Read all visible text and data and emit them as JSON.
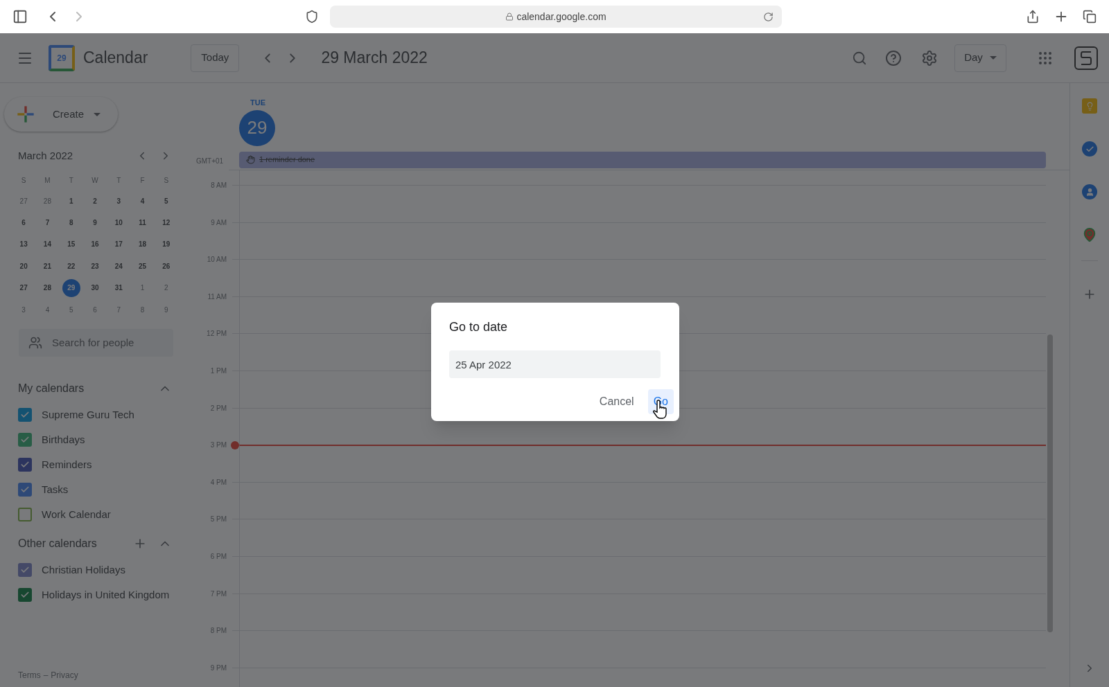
{
  "browser": {
    "url": "calendar.google.com"
  },
  "header": {
    "app_name": "Calendar",
    "logo_date": "29",
    "today_button": "Today",
    "title": "29 March 2022",
    "view_selector": "Day"
  },
  "create_button": "Create",
  "mini_calendar": {
    "month": "March 2022",
    "weekdays": [
      "S",
      "M",
      "T",
      "W",
      "T",
      "F",
      "S"
    ],
    "weeks": [
      [
        {
          "day": "27",
          "muted": true,
          "selected": false
        },
        {
          "day": "28",
          "muted": true,
          "selected": false
        },
        {
          "day": "1",
          "muted": false,
          "selected": false
        },
        {
          "day": "2",
          "muted": false,
          "selected": false
        },
        {
          "day": "3",
          "muted": false,
          "selected": false
        },
        {
          "day": "4",
          "muted": false,
          "selected": false
        },
        {
          "day": "5",
          "muted": false,
          "selected": false
        }
      ],
      [
        {
          "day": "6",
          "muted": false,
          "selected": false
        },
        {
          "day": "7",
          "muted": false,
          "selected": false
        },
        {
          "day": "8",
          "muted": false,
          "selected": false
        },
        {
          "day": "9",
          "muted": false,
          "selected": false
        },
        {
          "day": "10",
          "muted": false,
          "selected": false
        },
        {
          "day": "11",
          "muted": false,
          "selected": false
        },
        {
          "day": "12",
          "muted": false,
          "selected": false
        }
      ],
      [
        {
          "day": "13",
          "muted": false,
          "selected": false
        },
        {
          "day": "14",
          "muted": false,
          "selected": false
        },
        {
          "day": "15",
          "muted": false,
          "selected": false
        },
        {
          "day": "16",
          "muted": false,
          "selected": false
        },
        {
          "day": "17",
          "muted": false,
          "selected": false
        },
        {
          "day": "18",
          "muted": false,
          "selected": false
        },
        {
          "day": "19",
          "muted": false,
          "selected": false
        }
      ],
      [
        {
          "day": "20",
          "muted": false,
          "selected": false
        },
        {
          "day": "21",
          "muted": false,
          "selected": false
        },
        {
          "day": "22",
          "muted": false,
          "selected": false
        },
        {
          "day": "23",
          "muted": false,
          "selected": false
        },
        {
          "day": "24",
          "muted": false,
          "selected": false
        },
        {
          "day": "25",
          "muted": false,
          "selected": false
        },
        {
          "day": "26",
          "muted": false,
          "selected": false
        }
      ],
      [
        {
          "day": "27",
          "muted": false,
          "selected": false
        },
        {
          "day": "28",
          "muted": false,
          "selected": false
        },
        {
          "day": "29",
          "muted": false,
          "selected": true
        },
        {
          "day": "30",
          "muted": false,
          "selected": false
        },
        {
          "day": "31",
          "muted": false,
          "selected": false
        },
        {
          "day": "1",
          "muted": true,
          "selected": false
        },
        {
          "day": "2",
          "muted": true,
          "selected": false
        }
      ],
      [
        {
          "day": "3",
          "muted": true,
          "selected": false
        },
        {
          "day": "4",
          "muted": true,
          "selected": false
        },
        {
          "day": "5",
          "muted": true,
          "selected": false
        },
        {
          "day": "6",
          "muted": true,
          "selected": false
        },
        {
          "day": "7",
          "muted": true,
          "selected": false
        },
        {
          "day": "8",
          "muted": true,
          "selected": false
        },
        {
          "day": "9",
          "muted": true,
          "selected": false
        }
      ]
    ]
  },
  "people_search": {
    "placeholder": "Search for people"
  },
  "my_calendars": {
    "title": "My calendars",
    "expanded": true,
    "items": [
      {
        "name": "Supreme Guru Tech",
        "color": "#145271",
        "checked": true
      },
      {
        "name": "Birthdays",
        "color": "#285d46",
        "checked": true
      },
      {
        "name": "Reminders",
        "color": "#2c345e",
        "checked": true
      },
      {
        "name": "Tasks",
        "color": "#2e4977",
        "checked": true
      },
      {
        "name": "Work Calendar",
        "color": "#455b30",
        "checked": false
      }
    ]
  },
  "other_calendars": {
    "title": "Other calendars",
    "expanded": true,
    "items": [
      {
        "name": "Christian Holidays",
        "color": "#444967",
        "checked": true
      },
      {
        "name": "Holidays in United Kingdom",
        "color": "#174730",
        "checked": true
      }
    ]
  },
  "footer": {
    "terms": "Terms",
    "separator": "–",
    "privacy": "Privacy"
  },
  "day_view": {
    "weekday": "TUE",
    "date": "29",
    "timezone": "GMT+01",
    "all_day_events": [
      {
        "title": "1 reminder done",
        "done": true
      }
    ],
    "hours": [
      {
        "label": "8 AM",
        "now": false
      },
      {
        "label": "9 AM",
        "now": false
      },
      {
        "label": "10 AM",
        "now": false
      },
      {
        "label": "11 AM",
        "now": false
      },
      {
        "label": "12 PM",
        "now": false
      },
      {
        "label": "1 PM",
        "now": false
      },
      {
        "label": "2 PM",
        "now": false
      },
      {
        "label": "3 PM",
        "now": true
      },
      {
        "label": "4 PM",
        "now": false
      },
      {
        "label": "5 PM",
        "now": false
      },
      {
        "label": "6 PM",
        "now": false
      },
      {
        "label": "7 PM",
        "now": false
      },
      {
        "label": "8 PM",
        "now": false
      },
      {
        "label": "9 PM",
        "now": false
      }
    ]
  },
  "dialog": {
    "title": "Go to date",
    "value": "25 Apr 2022",
    "buttons": [
      {
        "label": "Cancel",
        "kind": "text"
      },
      {
        "label": "Go",
        "kind": "primary"
      }
    ]
  }
}
